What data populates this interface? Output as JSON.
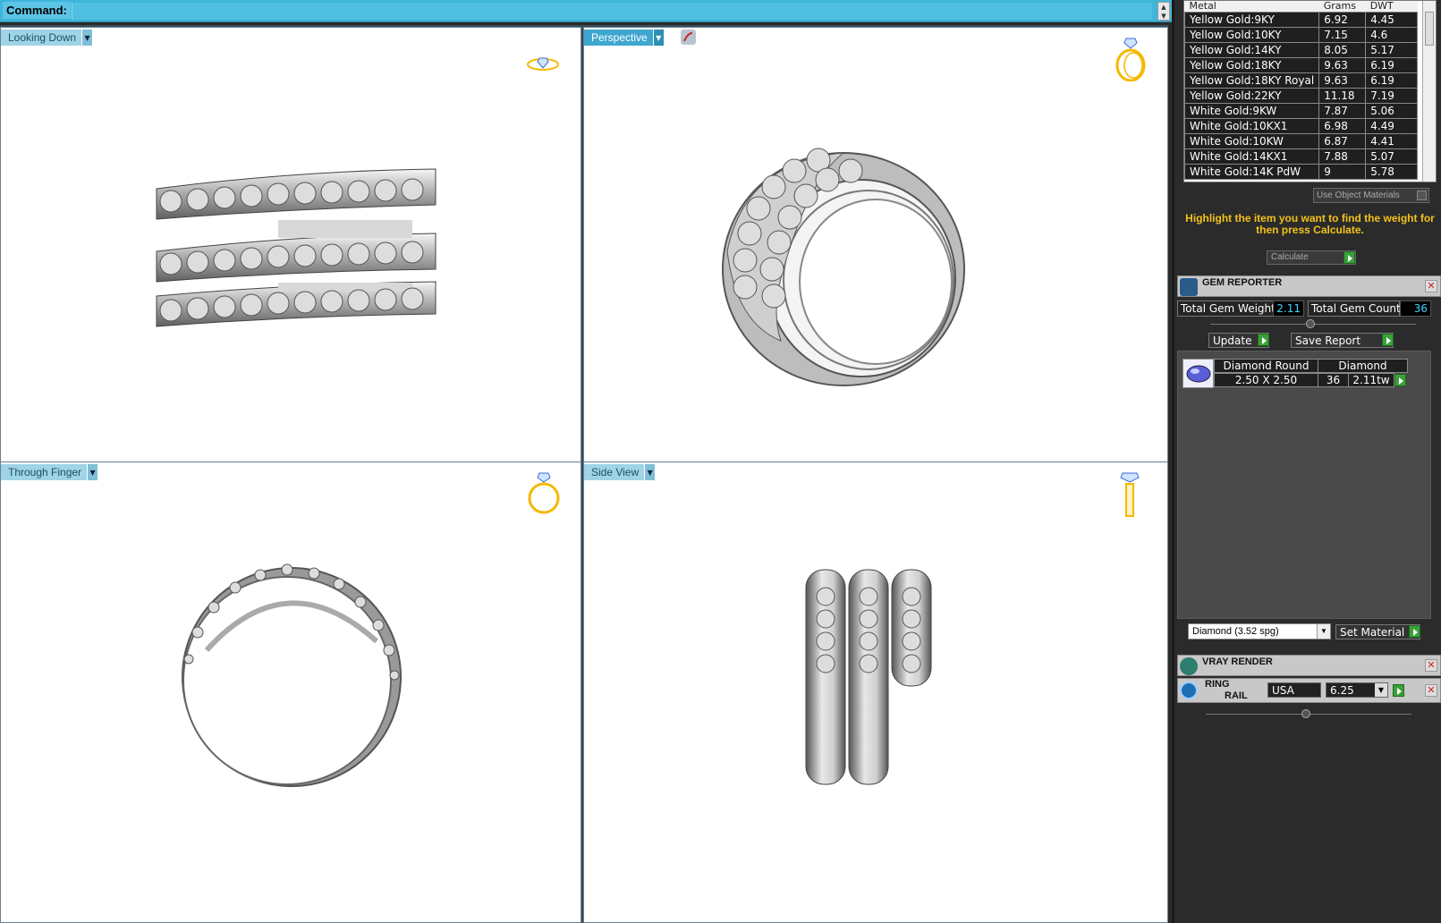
{
  "command_bar": {
    "label": "Command:",
    "value": ""
  },
  "viewports": {
    "top_left": {
      "label": "Looking Down"
    },
    "top_right": {
      "label": "Perspective"
    },
    "bottom_left": {
      "label": "Through Finger"
    },
    "bottom_right": {
      "label": "Side View"
    }
  },
  "metal_table": {
    "headers": [
      "Metal",
      "Grams",
      "DWT"
    ],
    "rows": [
      [
        "Yellow Gold:9KY",
        "6.92",
        "4.45"
      ],
      [
        "Yellow Gold:10KY",
        "7.15",
        "4.6"
      ],
      [
        "Yellow Gold:14KY",
        "8.05",
        "5.17"
      ],
      [
        "Yellow Gold:18KY",
        "9.63",
        "6.19"
      ],
      [
        "Yellow Gold:18KY Royal",
        "9.63",
        "6.19"
      ],
      [
        "Yellow Gold:22KY",
        "11.18",
        "7.19"
      ],
      [
        "White Gold:9KW",
        "7.87",
        "5.06"
      ],
      [
        "White Gold:10KX1",
        "6.98",
        "4.49"
      ],
      [
        "White Gold:10KW",
        "6.87",
        "4.41"
      ],
      [
        "White Gold:14KX1",
        "7.88",
        "5.07"
      ],
      [
        "White Gold:14K PdW",
        "9",
        "5.78"
      ]
    ],
    "use_object_materials": "Use Object Materials",
    "hint": "Highlight the item you want to find the weight for then press Calculate.",
    "calculate": "Calculate"
  },
  "gem_reporter": {
    "title": "GEM REPORTER",
    "total_weight_label": "Total Gem Weight",
    "total_weight": "2.11",
    "total_count_label": "Total Gem Count",
    "total_count": "36",
    "update": "Update",
    "save_report": "Save Report",
    "gems": [
      {
        "shape": "Diamond Round",
        "material": "Diamond",
        "size": "2.50 X 2.50",
        "count": "36",
        "weight": "2.11tw"
      }
    ],
    "material_select": "Diamond     (3.52 spg)",
    "set_material": "Set Material"
  },
  "vray": {
    "title": "VRAY RENDER"
  },
  "ring_rail": {
    "title1": "RING",
    "title2": "RAIL",
    "country": "USA",
    "size": "6.25"
  },
  "colors": {
    "accent": "#3fb5da",
    "hint": "#f2c21a",
    "value": "#3fd6ff",
    "go": "#3aa13a",
    "icon_gold": "#f5b800"
  },
  "icons": [
    "ring-top-icon",
    "ring-perspective-icon",
    "ring-front-icon",
    "ring-side-icon",
    "rotate-icon"
  ]
}
